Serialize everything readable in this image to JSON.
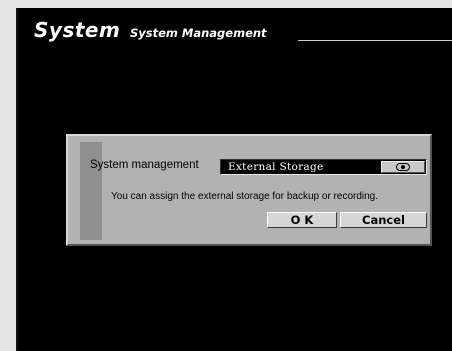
{
  "header": {
    "title": "System",
    "subtitle": "System Management"
  },
  "dialog": {
    "label": "System management",
    "select": {
      "value": "External Storage",
      "button_icon": "dropdown-toggle-icon"
    },
    "description": "You can assign the external storage for backup or recording.",
    "ok_label": "O K",
    "cancel_label": "Cancel"
  },
  "colors": {
    "page_background": "#e4e4e4",
    "screen_background": "#000000",
    "dialog_background": "#b2b2b2",
    "select_background": "#000000"
  }
}
